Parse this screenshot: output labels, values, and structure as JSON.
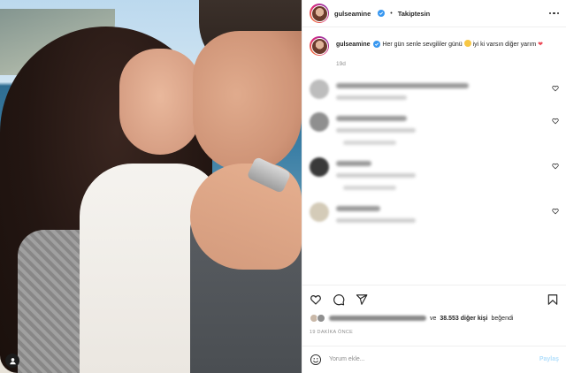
{
  "header": {
    "username": "gulseamine",
    "separator": "•",
    "follow_label": "Takiptesin"
  },
  "caption": {
    "username": "gulseamine",
    "text_part1": "Her gün senle sevgililer günü",
    "text_part2": "iyi ki varsın diğer yarım",
    "heart": "❤",
    "time": "19d"
  },
  "likes": {
    "prefix": "ve",
    "count_text": "38.553 diğer kişi",
    "suffix": "beğendi"
  },
  "post_time": "19 DAKİKA ÖNCE",
  "add_comment": {
    "placeholder": "Yorum ekle...",
    "post_label": "Paylaş"
  },
  "colors": {
    "verified": "#3897f0",
    "heart": "#ed4956",
    "post_disabled": "#b2dffc"
  }
}
